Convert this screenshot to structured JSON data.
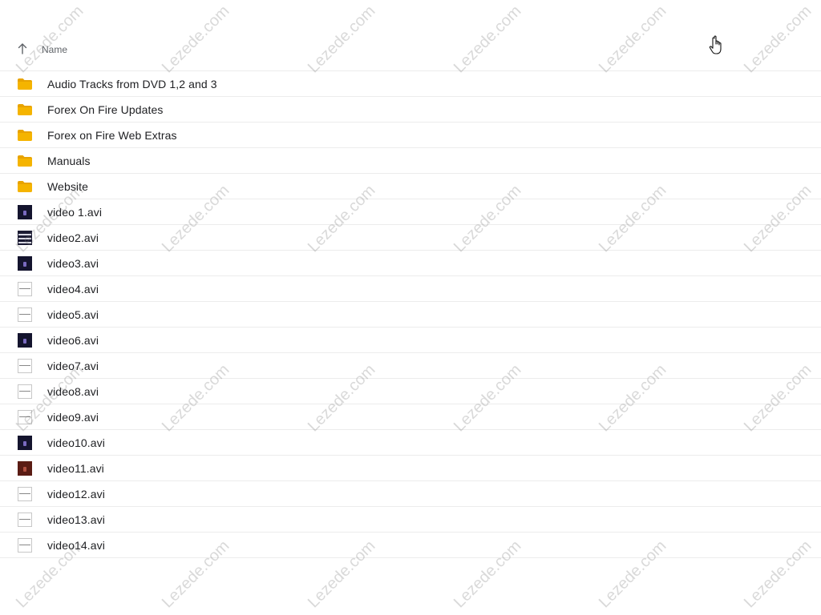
{
  "header": {
    "sort_icon": "arrow-up-icon",
    "name_column": "Name"
  },
  "items": [
    {
      "label": "Audio Tracks from DVD 1,2 and 3",
      "type": "folder",
      "icon": "folder-icon",
      "thumb": ""
    },
    {
      "label": "Forex On Fire Updates",
      "type": "folder",
      "icon": "folder-icon",
      "thumb": ""
    },
    {
      "label": "Forex on Fire Web Extras",
      "type": "folder",
      "icon": "folder-icon",
      "thumb": ""
    },
    {
      "label": "Manuals",
      "type": "folder",
      "icon": "folder-icon",
      "thumb": ""
    },
    {
      "label": "Website",
      "type": "folder",
      "icon": "folder-icon",
      "thumb": ""
    },
    {
      "label": "video 1.avi",
      "type": "video",
      "icon": "video-thumbnail-icon",
      "thumb": "dark"
    },
    {
      "label": "video2.avi",
      "type": "video",
      "icon": "video-thumbnail-icon",
      "thumb": "mixed"
    },
    {
      "label": "video3.avi",
      "type": "video",
      "icon": "video-thumbnail-icon",
      "thumb": "dark"
    },
    {
      "label": "video4.avi",
      "type": "video",
      "icon": "video-thumbnail-icon",
      "thumb": "light"
    },
    {
      "label": "video5.avi",
      "type": "video",
      "icon": "video-thumbnail-icon",
      "thumb": "light"
    },
    {
      "label": "video6.avi",
      "type": "video",
      "icon": "video-thumbnail-icon",
      "thumb": "dark"
    },
    {
      "label": "video7.avi",
      "type": "video",
      "icon": "video-thumbnail-icon",
      "thumb": "light"
    },
    {
      "label": "video8.avi",
      "type": "video",
      "icon": "video-thumbnail-icon",
      "thumb": "light"
    },
    {
      "label": "video9.avi",
      "type": "video",
      "icon": "video-thumbnail-icon",
      "thumb": "light"
    },
    {
      "label": "video10.avi",
      "type": "video",
      "icon": "video-thumbnail-icon",
      "thumb": "dark"
    },
    {
      "label": "video11.avi",
      "type": "video",
      "icon": "video-thumbnail-icon",
      "thumb": "darkred"
    },
    {
      "label": "video12.avi",
      "type": "video",
      "icon": "video-thumbnail-icon",
      "thumb": "light"
    },
    {
      "label": "video13.avi",
      "type": "video",
      "icon": "video-thumbnail-icon",
      "thumb": "light"
    },
    {
      "label": "video14.avi",
      "type": "video",
      "icon": "video-thumbnail-icon",
      "thumb": "light"
    }
  ],
  "watermark": {
    "text": "Lezede.com"
  },
  "colors": {
    "folder": "#f5b400",
    "folder_tab": "#e8a300",
    "divider": "#ececec",
    "text": "#202124",
    "header_text": "#5f6368"
  },
  "cursor_icon": "hand-pointer-icon"
}
